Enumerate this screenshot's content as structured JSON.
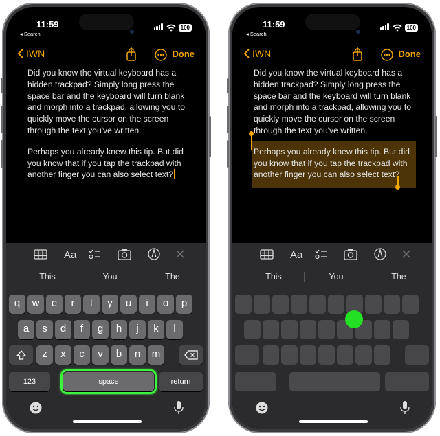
{
  "status_bar": {
    "time": "11:59",
    "back_label": "◂ Search",
    "battery": "100"
  },
  "nav": {
    "back_label": "IWN",
    "done_label": "Done"
  },
  "note": {
    "paragraph1": "Did you know the virtual keyboard has a hidden trackpad? Simply long press the space bar and the keyboard will turn blank and morph into a trackpad, allowing you to quickly move the cursor on the screen through the text you've written.",
    "paragraph2": "Perhaps you already knew this tip. But did you know that if you tap the trackpad with another finger you can also select text?"
  },
  "suggestions": [
    "This",
    "You",
    "The"
  ],
  "keyboard": {
    "row1": [
      "q",
      "w",
      "e",
      "r",
      "t",
      "y",
      "u",
      "i",
      "o",
      "p"
    ],
    "row2": [
      "a",
      "s",
      "d",
      "f",
      "g",
      "h",
      "j",
      "k",
      "l"
    ],
    "row3": [
      "z",
      "x",
      "c",
      "v",
      "b",
      "n",
      "m"
    ],
    "numbers_label": "123",
    "space_label": "space",
    "return_label": "return"
  },
  "toolbar_icons": [
    "table-icon",
    "text-format-icon",
    "checklist-icon",
    "camera-icon",
    "markup-icon",
    "close-icon"
  ],
  "colors": {
    "accent": "#f0a500",
    "highlight_green": "#3ef23e",
    "key": "#6b6b6e",
    "keyboard_bg": "#2b2b2d"
  }
}
